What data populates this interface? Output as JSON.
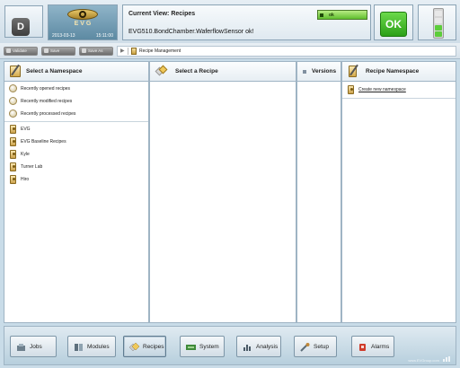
{
  "header": {
    "user_initial": "D",
    "logo_text": "EVG",
    "date": "2013-03-13",
    "time": "15:11:00",
    "current_view": "Current View: Recipes",
    "status_message": "EVG510.BondChamber.WaferflowSensor ok!",
    "mini_status_label": "ok",
    "ok_label": "OK",
    "status_color": "#2ca018"
  },
  "toolbar": {
    "validate_label": "Validate",
    "save_label": "Save",
    "save_as_label": "Save As",
    "breadcrumb": "Recipe Management"
  },
  "namespace_pane": {
    "title": "Select a Namespace",
    "recent": [
      {
        "label": "Recently opened recipes"
      },
      {
        "label": "Recently modified recipes"
      },
      {
        "label": "Recently processed recipes"
      }
    ],
    "namespaces": [
      {
        "label": "EVG"
      },
      {
        "label": "EVG Baseline Recipes"
      },
      {
        "label": "Kyle"
      },
      {
        "label": "Turner Lab"
      },
      {
        "label": "Hiro"
      }
    ]
  },
  "recipe_pane": {
    "title": "Select a Recipe"
  },
  "versions_pane": {
    "title": "Versions"
  },
  "recipe_namespace_pane": {
    "title": "Recipe Namespace",
    "create_link": "Create new namespace"
  },
  "dock": {
    "items": [
      {
        "label": "Jobs",
        "icon": "jobs-icon"
      },
      {
        "label": "Modules",
        "icon": "modules-icon"
      },
      {
        "label": "Recipes",
        "icon": "recipes-icon"
      },
      {
        "label": "System",
        "icon": "system-icon"
      },
      {
        "label": "Analysis",
        "icon": "analysis-icon"
      },
      {
        "label": "Setup",
        "icon": "setup-icon"
      },
      {
        "label": "Alarms",
        "icon": "alarms-icon"
      }
    ],
    "active": "Recipes",
    "footer": "www.EVGroup.com"
  }
}
